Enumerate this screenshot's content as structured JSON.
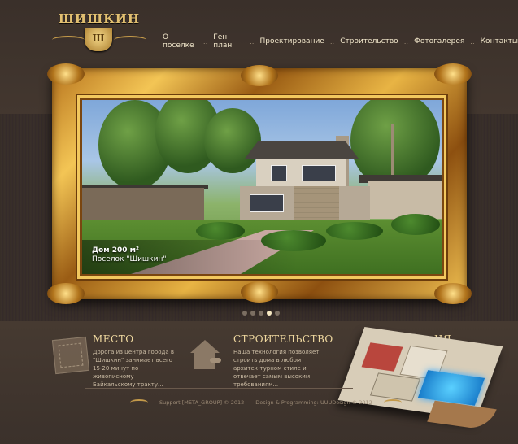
{
  "logo": {
    "text": "ШИШКИН",
    "emblem": "Ш"
  },
  "nav": {
    "items": [
      "О поселке",
      "Ген план",
      "Проектирование",
      "Строительство",
      "Фотогалерея",
      "Контакты"
    ],
    "separator": "::"
  },
  "slider": {
    "caption_title": "Дом 200 м²",
    "caption_subtitle": "Поселок \"Шишкин\"",
    "dots": 5,
    "active_dot": 4
  },
  "sections": {
    "place": {
      "title": "МЕСТО",
      "text": "Дорога из центра города в \"Шишкин\" занимает всего 15-20 минут по живописному Байкальскому тракту...",
      "icon": "map-icon"
    },
    "construction": {
      "title": "СТРОИТЕЛЬСТВО",
      "text": "Наша технология позволяет строить дома в любом архитек-турном стиле и отвечает самым высоким требованиям...",
      "icon": "house-key-icon"
    },
    "planning_partial_title": "ИЯ"
  },
  "footer": {
    "support": "Support [META_GROUP] © 2012",
    "design": "Design & Programming: UUUDesign © 2012"
  },
  "colors": {
    "accent": "#f0d9a0",
    "gold": "#e2c071",
    "background": "#3f3530"
  }
}
